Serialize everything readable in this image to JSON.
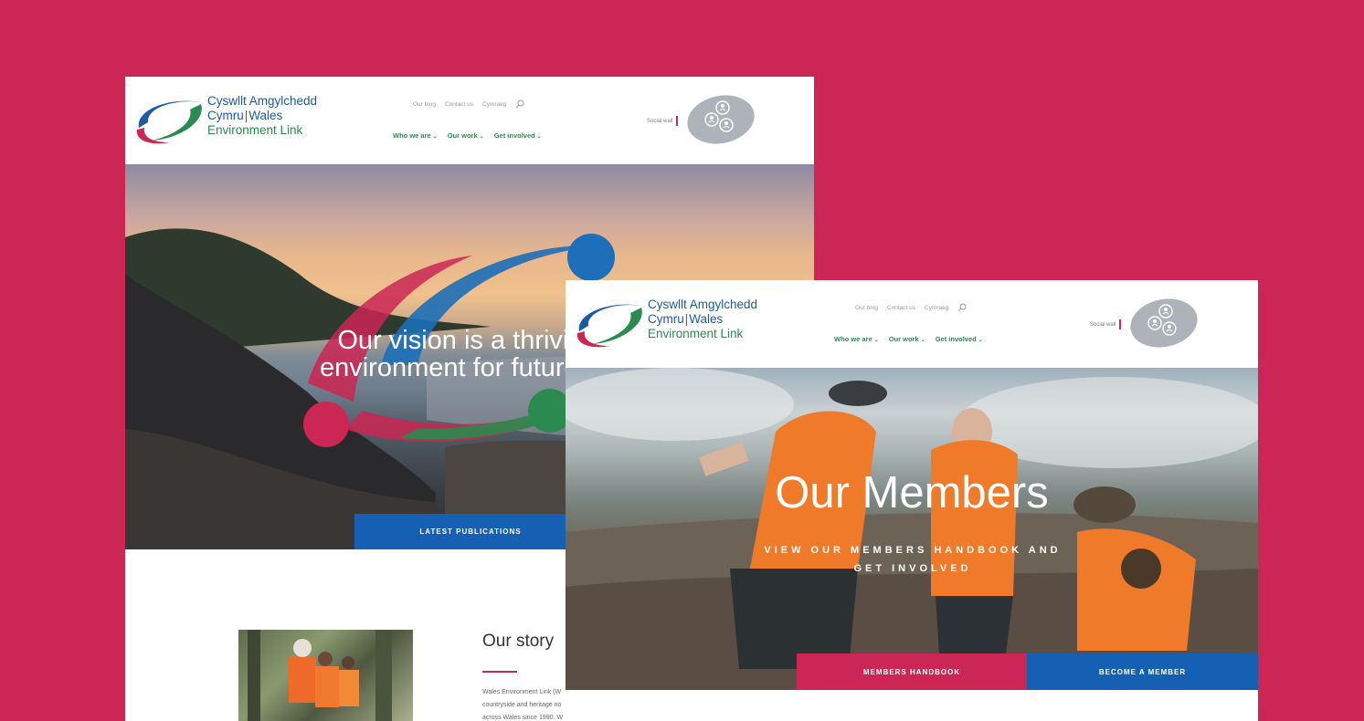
{
  "home": {
    "logo": {
      "line1": "Cyswllt Amgylchedd",
      "line2_cy": "Cymru",
      "line2_sep": "|",
      "line2_en": "Wales",
      "line3": "Environment Link"
    },
    "util_nav": [
      "Our blog",
      "Contact us",
      "Cymraeg"
    ],
    "main_nav": [
      "Who we are",
      "Our work",
      "Get involved"
    ],
    "social_wall": "Social wall",
    "hero_line1": "Our vision is a thriving",
    "hero_line2": "environment for future ge",
    "latest_publications": "LATEST PUBLICATIONS",
    "story_title": "Our story",
    "story_lines": [
      "Wales Environment Link (W",
      "countryside and heritage no",
      "across Wales since 1990. W"
    ]
  },
  "members": {
    "logo": {
      "line1": "Cyswllt Amgylchedd",
      "line2_cy": "Cymru",
      "line2_sep": "|",
      "line2_en": "Wales",
      "line3": "Environment Link"
    },
    "util_nav": [
      "Our blog",
      "Contact us",
      "Cymraeg"
    ],
    "main_nav": [
      "Who we are",
      "Our work",
      "Get involved"
    ],
    "social_wall": "Social wall",
    "hero_title": "Our Members",
    "hero_sub": "VIEW OUR MEMBERS HANDBOOK AND GET INVOLVED",
    "members_handbook": "MEMBERS HANDBOOK",
    "become_member": "BECOME A MEMBER"
  },
  "colors": {
    "background": "#CB2654",
    "brand_blue": "#1560B2",
    "brand_red": "#CB2654",
    "brand_green": "#2B8A4F"
  },
  "icons": {
    "search": "search-icon",
    "chevron": "chevron-down-icon",
    "social_badge": "people-chat-icon"
  }
}
